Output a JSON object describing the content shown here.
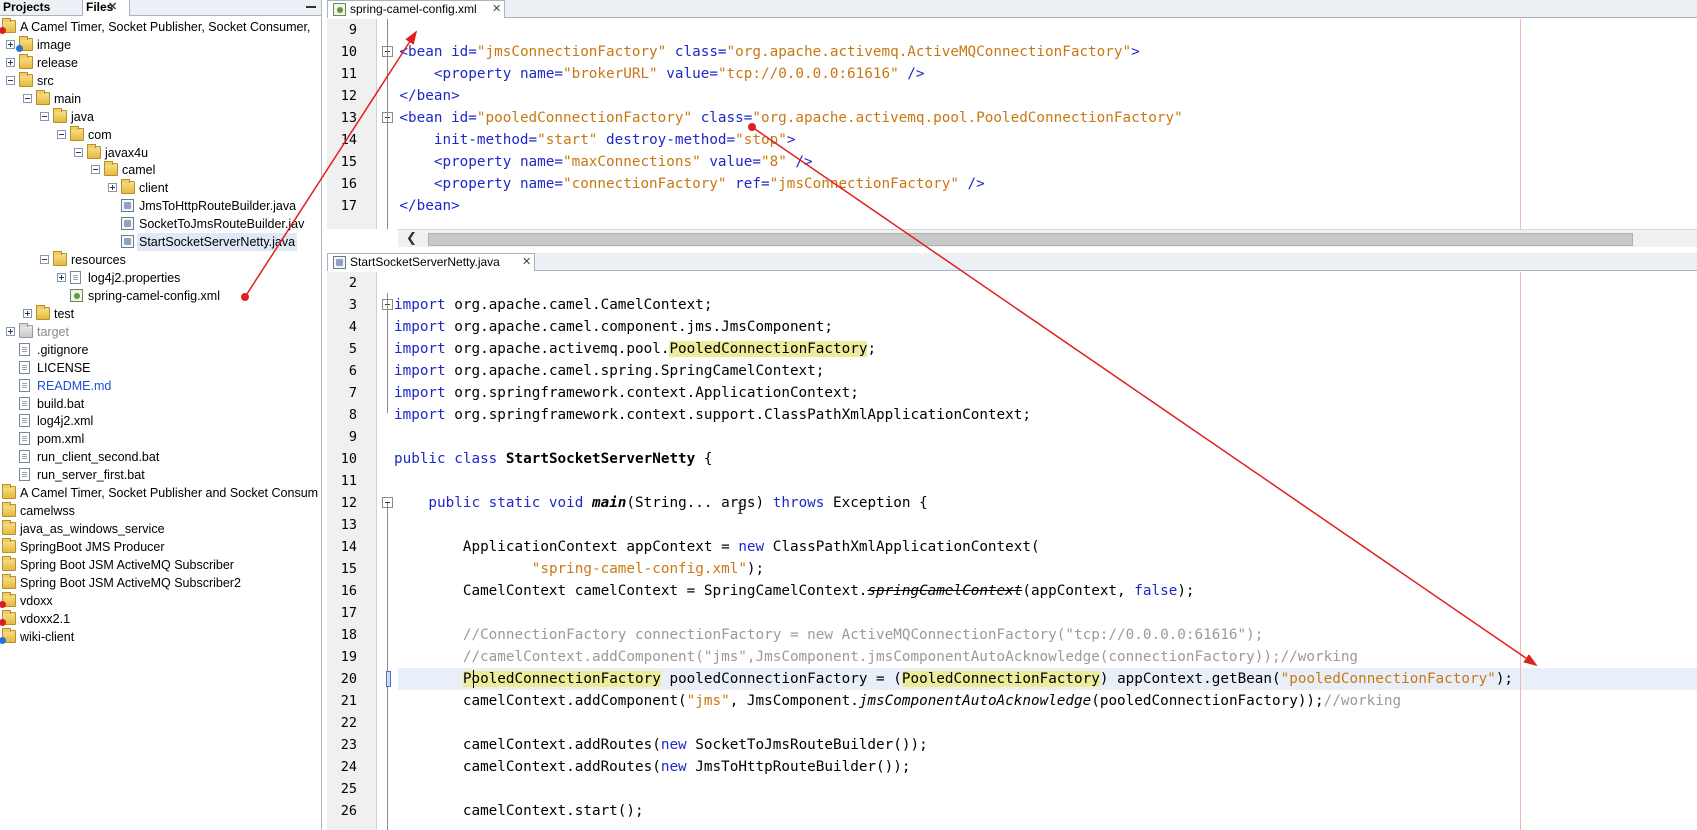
{
  "left_panel": {
    "tabs": [
      {
        "label": "Projects",
        "active": false
      },
      {
        "label": "Files",
        "active": true
      }
    ],
    "tree": [
      {
        "label": "A Camel Timer, Socket Publisher, Socket Consumer,",
        "icon": "project-folder-icon"
      },
      {
        "label": "image",
        "icon": "folder-icon"
      },
      {
        "label": "release",
        "icon": "folder-icon"
      },
      {
        "label": "src",
        "icon": "folder-icon"
      },
      {
        "label": "main",
        "icon": "folder-icon"
      },
      {
        "label": "java",
        "icon": "folder-icon"
      },
      {
        "label": "com",
        "icon": "folder-icon"
      },
      {
        "label": "javax4u",
        "icon": "folder-icon"
      },
      {
        "label": "camel",
        "icon": "folder-icon"
      },
      {
        "label": "client",
        "icon": "folder-icon"
      },
      {
        "label": "JmsToHttpRouteBuilder.java",
        "icon": "java-file-icon"
      },
      {
        "label": "SocketToJmsRouteBuilder.jav",
        "icon": "java-file-icon"
      },
      {
        "label": "StartSocketServerNetty.java",
        "icon": "java-file-icon"
      },
      {
        "label": "resources",
        "icon": "folder-icon"
      },
      {
        "label": "log4j2.properties",
        "icon": "properties-file-icon"
      },
      {
        "label": "spring-camel-config.xml",
        "icon": "xml-config-file-icon"
      },
      {
        "label": "test",
        "icon": "folder-icon"
      },
      {
        "label": "target",
        "icon": "folder-icon"
      },
      {
        "label": ".gitignore",
        "icon": "file-icon"
      },
      {
        "label": "LICENSE",
        "icon": "file-icon"
      },
      {
        "label": "README.md",
        "icon": "file-icon"
      },
      {
        "label": "build.bat",
        "icon": "file-icon"
      },
      {
        "label": "log4j2.xml",
        "icon": "xml-file-icon"
      },
      {
        "label": "pom.xml",
        "icon": "xml-file-icon"
      },
      {
        "label": "run_client_second.bat",
        "icon": "file-icon"
      },
      {
        "label": "run_server_first.bat",
        "icon": "file-icon"
      },
      {
        "label": "A Camel Timer, Socket Publisher and Socket Consum",
        "icon": "project-folder-icon"
      },
      {
        "label": "camelwss",
        "icon": "project-folder-icon"
      },
      {
        "label": "java_as_windows_service",
        "icon": "project-folder-icon"
      },
      {
        "label": "SpringBoot JMS Producer",
        "icon": "project-folder-icon"
      },
      {
        "label": "Spring Boot JSM ActiveMQ Subscriber",
        "icon": "project-folder-icon"
      },
      {
        "label": "Spring Boot JSM ActiveMQ Subscriber2",
        "icon": "project-folder-icon"
      },
      {
        "label": "vdoxx",
        "icon": "project-folder-icon"
      },
      {
        "label": "vdoxx2.1",
        "icon": "project-folder-icon"
      },
      {
        "label": "wiki-client",
        "icon": "project-folder-icon"
      }
    ]
  },
  "editor_top": {
    "tab_label": "spring-camel-config.xml",
    "lines": [
      {
        "num": "9",
        "tokens": []
      },
      {
        "num": "10",
        "tokens": [
          {
            "t": "    <bean ",
            "c": "t-tag"
          },
          {
            "t": "id=",
            "c": "t-attr"
          },
          {
            "t": "\"jmsConnectionFactory\"",
            "c": "t-val"
          },
          {
            "t": " class=",
            "c": "t-attr"
          },
          {
            "t": "\"org.apache.activemq.ActiveMQConnectionFactory\"",
            "c": "t-val"
          },
          {
            "t": ">",
            "c": "t-tag"
          }
        ]
      },
      {
        "num": "11",
        "tokens": [
          {
            "t": "        <property ",
            "c": "t-tag"
          },
          {
            "t": "name=",
            "c": "t-attr"
          },
          {
            "t": "\"brokerURL\"",
            "c": "t-val"
          },
          {
            "t": " value=",
            "c": "t-attr"
          },
          {
            "t": "\"tcp://0.0.0.0:61616\"",
            "c": "t-val"
          },
          {
            "t": " />",
            "c": "t-tag"
          }
        ]
      },
      {
        "num": "12",
        "tokens": [
          {
            "t": "    </bean>",
            "c": "t-tag"
          }
        ]
      },
      {
        "num": "13",
        "tokens": [
          {
            "t": "    <bean ",
            "c": "t-tag"
          },
          {
            "t": "id=",
            "c": "t-attr"
          },
          {
            "t": "\"pooledConnectionFactory\"",
            "c": "t-val"
          },
          {
            "t": " class=",
            "c": "t-attr"
          },
          {
            "t": "\"org.apache.activemq.pool.PooledConnectionFactory\"",
            "c": "t-val"
          }
        ]
      },
      {
        "num": "14",
        "tokens": [
          {
            "t": "        init-method=",
            "c": "t-attr"
          },
          {
            "t": "\"start\"",
            "c": "t-val"
          },
          {
            "t": " destroy-method=",
            "c": "t-attr"
          },
          {
            "t": "\"stop\"",
            "c": "t-val"
          },
          {
            "t": ">",
            "c": "t-tag"
          }
        ]
      },
      {
        "num": "15",
        "tokens": [
          {
            "t": "        <property ",
            "c": "t-tag"
          },
          {
            "t": "name=",
            "c": "t-attr"
          },
          {
            "t": "\"maxConnections\"",
            "c": "t-val"
          },
          {
            "t": " value=",
            "c": "t-attr"
          },
          {
            "t": "\"8\"",
            "c": "t-val"
          },
          {
            "t": " />",
            "c": "t-tag"
          }
        ]
      },
      {
        "num": "16",
        "tokens": [
          {
            "t": "        <property ",
            "c": "t-tag"
          },
          {
            "t": "name=",
            "c": "t-attr"
          },
          {
            "t": "\"connectionFactory\"",
            "c": "t-val"
          },
          {
            "t": " ref=",
            "c": "t-attr"
          },
          {
            "t": "\"jmsConnectionFactory\"",
            "c": "t-val"
          },
          {
            "t": " />",
            "c": "t-tag"
          }
        ]
      },
      {
        "num": "17",
        "tokens": [
          {
            "t": "    </bean>",
            "c": "t-tag"
          }
        ]
      }
    ]
  },
  "editor_bottom": {
    "tab_label": "StartSocketServerNetty.java",
    "lines": [
      {
        "num": "2",
        "tokens": []
      },
      {
        "num": "3",
        "tokens": [
          {
            "t": "import",
            "c": "t-kw"
          },
          {
            "t": " org.apache.camel.CamelContext;",
            "c": ""
          }
        ]
      },
      {
        "num": "4",
        "tokens": [
          {
            "t": "import",
            "c": "t-kw"
          },
          {
            "t": " org.apache.camel.component.jms.JmsComponent;",
            "c": ""
          }
        ]
      },
      {
        "num": "5",
        "tokens": [
          {
            "t": "import",
            "c": "t-kw"
          },
          {
            "t": " org.apache.activemq.pool.",
            "c": ""
          },
          {
            "t": "PooledConnectionFactory",
            "c": "t-hl"
          },
          {
            "t": ";",
            "c": ""
          }
        ]
      },
      {
        "num": "6",
        "tokens": [
          {
            "t": "import",
            "c": "t-kw"
          },
          {
            "t": " org.apache.camel.spring.SpringCamelContext;",
            "c": ""
          }
        ]
      },
      {
        "num": "7",
        "tokens": [
          {
            "t": "import",
            "c": "t-kw"
          },
          {
            "t": " org.springframework.context.ApplicationContext;",
            "c": ""
          }
        ]
      },
      {
        "num": "8",
        "tokens": [
          {
            "t": "import",
            "c": "t-kw"
          },
          {
            "t": " org.springframework.context.support.ClassPathXmlApplicationContext;",
            "c": ""
          }
        ]
      },
      {
        "num": "9",
        "tokens": []
      },
      {
        "num": "10",
        "tokens": [
          {
            "t": "public class",
            "c": "t-kw"
          },
          {
            "t": " ",
            "c": ""
          },
          {
            "t": "StartSocketServerNetty",
            "c": "t-bold"
          },
          {
            "t": " {",
            "c": ""
          }
        ]
      },
      {
        "num": "11",
        "tokens": []
      },
      {
        "num": "12",
        "tokens": [
          {
            "t": "    public static void",
            "c": "t-kw"
          },
          {
            "t": " ",
            "c": ""
          },
          {
            "t": "main",
            "c": "t-bold t-it"
          },
          {
            "t": "(String... args) ",
            "c": ""
          },
          {
            "t": "throws",
            "c": "t-kw"
          },
          {
            "t": " Exception {",
            "c": ""
          }
        ]
      },
      {
        "num": "13",
        "tokens": []
      },
      {
        "num": "14",
        "tokens": [
          {
            "t": "        ApplicationContext appContext = ",
            "c": ""
          },
          {
            "t": "new",
            "c": "t-kw"
          },
          {
            "t": " ClassPathXmlApplicationContext(",
            "c": ""
          }
        ]
      },
      {
        "num": "15",
        "tokens": [
          {
            "t": "                ",
            "c": ""
          },
          {
            "t": "\"spring-camel-config.xml\"",
            "c": "t-str"
          },
          {
            "t": ");",
            "c": ""
          }
        ]
      },
      {
        "num": "16",
        "tokens": [
          {
            "t": "        CamelContext camelContext = SpringCamelContext.",
            "c": ""
          },
          {
            "t": "springCamelContext",
            "c": "t-strike"
          },
          {
            "t": "(appContext, ",
            "c": ""
          },
          {
            "t": "false",
            "c": "t-kw"
          },
          {
            "t": ");",
            "c": ""
          }
        ]
      },
      {
        "num": "17",
        "tokens": []
      },
      {
        "num": "18",
        "tokens": [
          {
            "t": "        //ConnectionFactory connectionFactory = new ActiveMQConnectionFactory(\"tcp://0.0.0.0:61616\");",
            "c": "t-cmt"
          }
        ]
      },
      {
        "num": "19",
        "tokens": [
          {
            "t": "        //camelContext.addComponent(\"jms\",JmsComponent.jmsComponentAutoAcknowledge(connectionFactory));//working",
            "c": "t-cmt"
          }
        ]
      },
      {
        "num": "20",
        "tokens": [
          {
            "t": "        ",
            "c": ""
          },
          {
            "t": "PooledConnectionFactory",
            "c": "t-hl"
          },
          {
            "t": " pooledConnectionFactory = (",
            "c": ""
          },
          {
            "t": "PooledConnectionFactory",
            "c": "t-hl"
          },
          {
            "t": ") appContext.getBean(",
            "c": ""
          },
          {
            "t": "\"pooledConnectionFactory\"",
            "c": "t-str"
          },
          {
            "t": ");",
            "c": ""
          }
        ]
      },
      {
        "num": "21",
        "tokens": [
          {
            "t": "        camelContext.addComponent(",
            "c": ""
          },
          {
            "t": "\"jms\"",
            "c": "t-str"
          },
          {
            "t": ", JmsComponent.",
            "c": ""
          },
          {
            "t": "jmsComponentAutoAcknowledge",
            "c": "t-it"
          },
          {
            "t": "(pooledConnectionFactory));",
            "c": ""
          },
          {
            "t": "//working",
            "c": "t-cmt"
          }
        ]
      },
      {
        "num": "22",
        "tokens": []
      },
      {
        "num": "23",
        "tokens": [
          {
            "t": "        camelContext.addRoutes(",
            "c": ""
          },
          {
            "t": "new",
            "c": "t-kw"
          },
          {
            "t": " SocketToJmsRouteBuilder());",
            "c": ""
          }
        ]
      },
      {
        "num": "24",
        "tokens": [
          {
            "t": "        camelContext.addRoutes(",
            "c": ""
          },
          {
            "t": "new",
            "c": "t-kw"
          },
          {
            "t": " JmsToHttpRouteBuilder());",
            "c": ""
          }
        ]
      },
      {
        "num": "25",
        "tokens": []
      },
      {
        "num": "26",
        "tokens": [
          {
            "t": "        camelContext.start();",
            "c": ""
          }
        ]
      }
    ]
  },
  "colors": {
    "annotation_arrow": "#e02020",
    "keyword": "#1e28c8",
    "string": "#c87813",
    "comment": "#9a9a9a",
    "highlight": "#ecec9a"
  }
}
